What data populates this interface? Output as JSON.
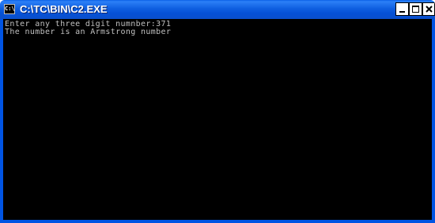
{
  "window": {
    "title": "C:\\TC\\BIN\\C2.EXE",
    "icon_label": "C:\\",
    "controls": {
      "minimize": "minimize-icon",
      "maximize": "maximize-icon",
      "close": "close-icon"
    }
  },
  "console": {
    "lines": [
      "Enter any three digit numnber:371",
      "The number is an Armstrong number"
    ]
  },
  "colors": {
    "titlebar": "#0054e3",
    "console_bg": "#000000",
    "console_text": "#c0c0c0"
  }
}
